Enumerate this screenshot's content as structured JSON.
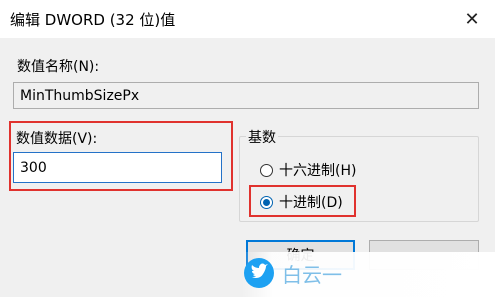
{
  "window": {
    "title": "编辑 DWORD (32 位)值",
    "close_icon": "close-icon"
  },
  "value_name": {
    "label": "数值名称(N):",
    "value": "MinThumbSizePx"
  },
  "value_data": {
    "label": "数值数据(V):",
    "value": "300"
  },
  "base": {
    "title": "基数",
    "options": [
      {
        "label": "十六进制(H)",
        "checked": false
      },
      {
        "label": "十进制(D)",
        "checked": true
      }
    ]
  },
  "buttons": {
    "ok": "确定"
  },
  "watermark": {
    "text": "白云一",
    "icon": "twitter-bird-icon"
  },
  "colors": {
    "accent": "#0078d7",
    "highlight": "#e0322e",
    "watermark_bird": "#1da1f2"
  }
}
